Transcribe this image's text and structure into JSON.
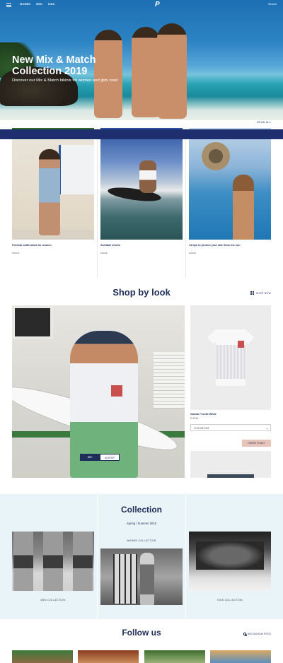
{
  "header": {
    "nav": [
      "Women",
      "Men",
      "Kids"
    ],
    "logo": "P",
    "search": "Search"
  },
  "hero": {
    "title": "New Mix & Match Collection 2019",
    "subtitle": "Discover our Mix & Match bikinis for women and girls now!"
  },
  "blog": {
    "read_all": "Read all",
    "articles": [
      {
        "title": "Festival outfit ideas for women",
        "more": "More"
      },
      {
        "title": "Surfable shorts",
        "more": "More"
      },
      {
        "title": "13 tips to protect your skin from the sun",
        "more": "More"
      }
    ]
  },
  "shop_by_look": {
    "title": "Shop by look",
    "shop_now": "Shop now",
    "look_buttons": [
      "Bee",
      "Achter"
    ],
    "product": {
      "name": "Gustav T-shirt White",
      "price": "€ 39,95",
      "size_placeholder": "Choose size",
      "add_to_cart": "Order to buy"
    }
  },
  "collection": {
    "title": "Collection",
    "season": "Spring / Summer 2019",
    "items": [
      "Men collection",
      "Women collection",
      "Kids collection"
    ]
  },
  "follow": {
    "title": "Follow us",
    "instagram": "Instagram Feed"
  },
  "colors": {
    "navy": "#1f2d5a",
    "stripe": "#1e2e6e",
    "collection_bg": "#e9f4f9",
    "cta": "#e8c3b9"
  },
  "icons": [
    "menu-icon",
    "logo-icon",
    "grid-icon",
    "chevron-down-icon",
    "instagram-icon"
  ]
}
